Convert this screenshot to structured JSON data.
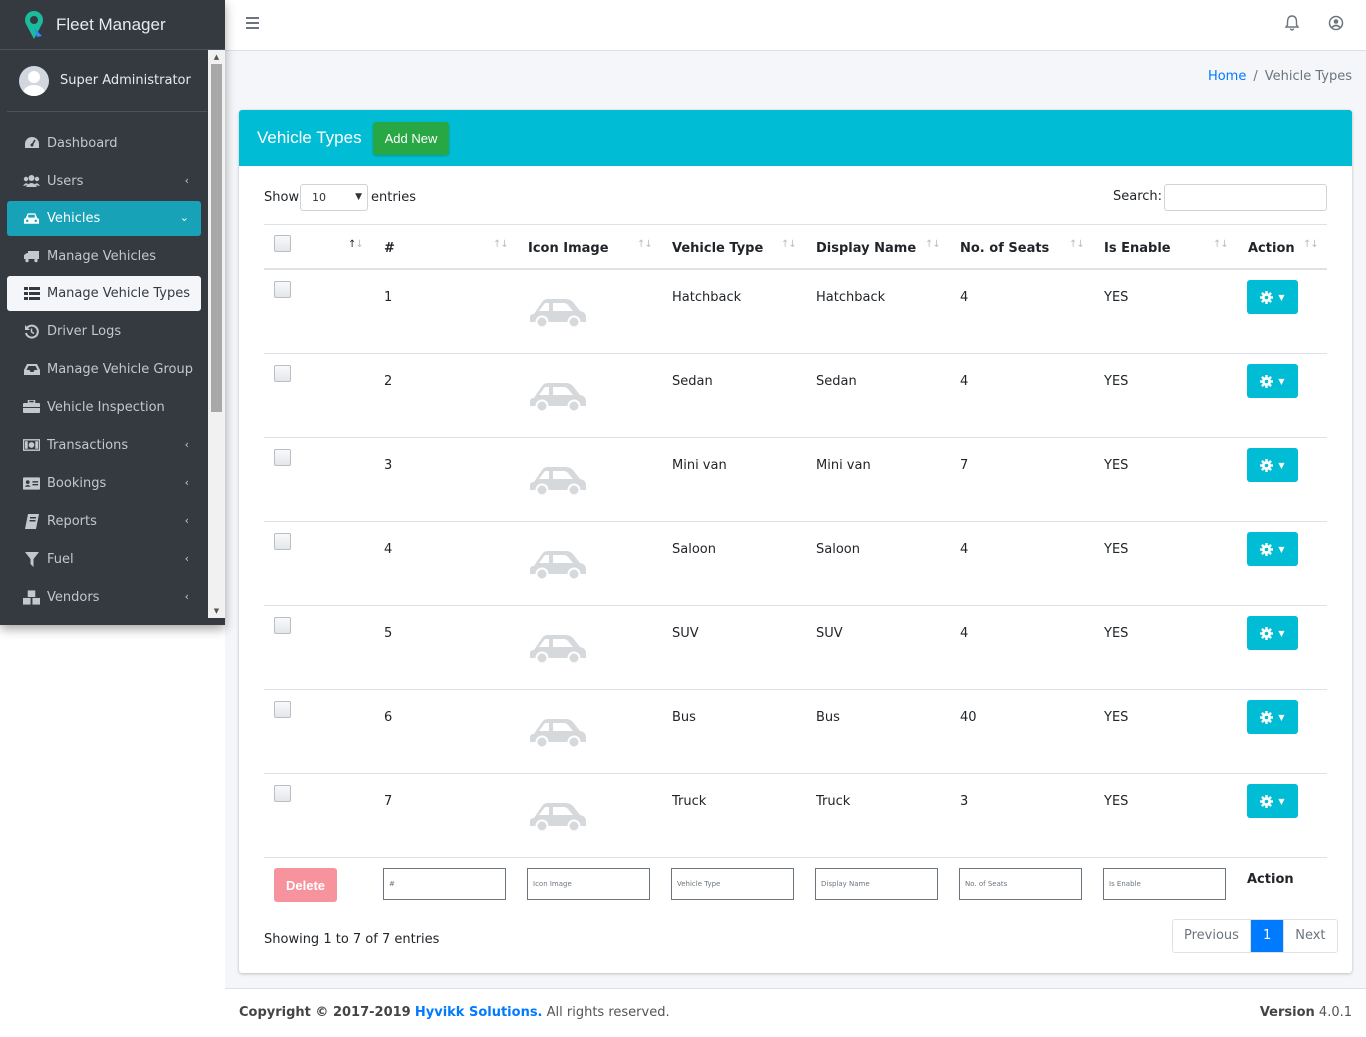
{
  "app": {
    "brand": "Fleet Manager",
    "user_name": "Super Administrator"
  },
  "sidebar": {
    "items": [
      {
        "label": "Dashboard",
        "icon": "dashboard-icon"
      },
      {
        "label": "Users",
        "icon": "users-icon"
      },
      {
        "label": "Vehicles",
        "icon": "car-icon"
      },
      {
        "label": "Manage Vehicles",
        "icon": "truck-icon"
      },
      {
        "label": "Manage Vehicle Types",
        "icon": "list-icon"
      },
      {
        "label": "Driver Logs",
        "icon": "history-icon"
      },
      {
        "label": "Manage Vehicle Group",
        "icon": "inbox-icon"
      },
      {
        "label": "Vehicle Inspection",
        "icon": "briefcase-icon"
      },
      {
        "label": "Transactions",
        "icon": "money-icon"
      },
      {
        "label": "Bookings",
        "icon": "address-card-icon"
      },
      {
        "label": "Reports",
        "icon": "book-icon"
      },
      {
        "label": "Fuel",
        "icon": "filter-icon"
      },
      {
        "label": "Vendors",
        "icon": "cubes-icon"
      }
    ]
  },
  "breadcrumb": {
    "home": "Home",
    "sep": "/",
    "current": "Vehicle Types"
  },
  "card": {
    "title": "Vehicle Types",
    "add_new": "Add New"
  },
  "controls": {
    "show": "Show",
    "page_size": "10",
    "entries": "entries",
    "search": "Search:"
  },
  "table": {
    "columns": [
      "#",
      "Icon Image",
      "Vehicle Type",
      "Display Name",
      "No. of Seats",
      "Is Enable",
      "Action"
    ],
    "rows": [
      {
        "id": "1",
        "type": "Hatchback",
        "display": "Hatchback",
        "seats": "4",
        "enable": "YES"
      },
      {
        "id": "2",
        "type": "Sedan",
        "display": "Sedan",
        "seats": "4",
        "enable": "YES"
      },
      {
        "id": "3",
        "type": "Mini van",
        "display": "Mini van",
        "seats": "7",
        "enable": "YES"
      },
      {
        "id": "4",
        "type": "Saloon",
        "display": "Saloon",
        "seats": "4",
        "enable": "YES"
      },
      {
        "id": "5",
        "type": "SUV",
        "display": "SUV",
        "seats": "4",
        "enable": "YES"
      },
      {
        "id": "6",
        "type": "Bus",
        "display": "Bus",
        "seats": "40",
        "enable": "YES"
      },
      {
        "id": "7",
        "type": "Truck",
        "display": "Truck",
        "seats": "3",
        "enable": "YES"
      }
    ],
    "footer": {
      "delete": "Delete",
      "filters": [
        "#",
        "Icon Image",
        "Vehicle Type",
        "Display Name",
        "No. of Seats",
        "Is Enable"
      ],
      "action": "Action"
    }
  },
  "pagination": {
    "info": "Showing 1 to 7 of 7 entries",
    "previous": "Previous",
    "page": "1",
    "next": "Next"
  },
  "footer": {
    "copyright_prefix": "Copyright © 2017-2019",
    "company": "Hyvikk Solutions.",
    "rights": "All rights reserved.",
    "version_label": "Version",
    "version": "4.0.1"
  },
  "colors": {
    "sidebar": "#343a40",
    "accent": "#00bcd4",
    "active_nav": "#17a2b8",
    "add_button": "#28a745",
    "delete_button": "#f7939d",
    "link": "#007bff"
  }
}
